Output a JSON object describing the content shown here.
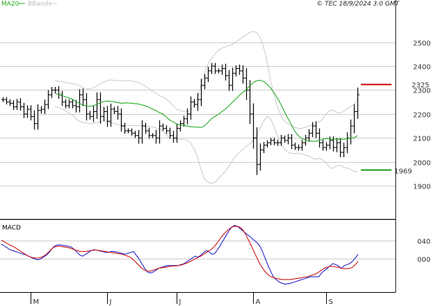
{
  "copyright": "© TEC 18/9/2024 3:0 GMT",
  "colors": {
    "bars": "#000000",
    "ma": "#22aa22",
    "bands": "#c8c8c8",
    "grid": "#cccccc",
    "resistance": "#cc0000",
    "support": "#119911",
    "macd": "#2222cc",
    "signal": "#cc1111",
    "frame": "#000000"
  },
  "chart_data": [
    {
      "type": "ohlc",
      "legend": [
        "MA20",
        "BBands"
      ],
      "y_ticks": [
        "2500",
        "2400",
        "2300",
        "2200",
        "2100",
        "2000",
        "1900"
      ],
      "ylim": [
        1805,
        2612
      ],
      "x_ticks": [
        "M",
        "J",
        "J",
        "A",
        "S"
      ],
      "x_tick_index": [
        8,
        30,
        50,
        72,
        93
      ],
      "levels": [
        {
          "name": "resistance",
          "label": "2325",
          "value": 2325
        },
        {
          "name": "support",
          "label": "1969",
          "value": 1969
        }
      ],
      "close": [
        2260,
        2250,
        2245,
        2230,
        2250,
        2230,
        2200,
        2220,
        2190,
        2160,
        2215,
        2220,
        2240,
        2280,
        2300,
        2300,
        2280,
        2250,
        2235,
        2250,
        2235,
        2230,
        2280,
        2260,
        2200,
        2190,
        2210,
        2260,
        2190,
        2210,
        2170,
        2220,
        2210,
        2200,
        2150,
        2130,
        2130,
        2120,
        2110,
        2100,
        2150,
        2130,
        2110,
        2110,
        2100,
        2150,
        2140,
        2130,
        2110,
        2100,
        2140,
        2160,
        2180,
        2200,
        2250,
        2240,
        2260,
        2320,
        2350,
        2380,
        2400,
        2380,
        2380,
        2390,
        2360,
        2320,
        2370,
        2390,
        2380,
        2350,
        2300,
        2200,
        2100,
        1990,
        2050,
        2070,
        2080,
        2090,
        2080,
        2080,
        2100,
        2090,
        2100,
        2070,
        2060,
        2060,
        2080,
        2100,
        2120,
        2150,
        2120,
        2080,
        2060,
        2070,
        2090,
        2060,
        2080,
        2040,
        2060,
        2100,
        2150,
        2210,
        2280
      ],
      "ma20": [
        2285,
        2282,
        2277,
        2272,
        2267,
        2262,
        2252,
        2245,
        2238,
        2234,
        2232,
        2235,
        2240,
        2247,
        2252,
        2254,
        2253,
        2251,
        2248,
        2245,
        2246,
        2246,
        2245,
        2243,
        2242,
        2238,
        2234,
        2228,
        2221,
        2215,
        2206,
        2200,
        2188,
        2175,
        2167,
        2159,
        2155,
        2152,
        2150,
        2147,
        2146,
        2145,
        2144,
        2150,
        2165,
        2180,
        2190,
        2198,
        2210,
        2220,
        2233,
        2248,
        2262,
        2277,
        2290,
        2302,
        2317,
        2330,
        2339,
        2341,
        2336,
        2325,
        2309,
        2289,
        2266,
        2240,
        2209,
        2182,
        2155,
        2128,
        2109,
        2099,
        2092,
        2088,
        2086,
        2086,
        2090,
        2094,
        2098,
        2096,
        2094,
        2095,
        2095,
        2094,
        2097,
        2100,
        2100,
        2110
      ],
      "bb_upper": [
        2340,
        2337,
        2334,
        2331,
        2329,
        2327,
        2324,
        2319,
        2311,
        2305,
        2305,
        2309,
        2316,
        2326,
        2333,
        2339,
        2342,
        2341,
        2339,
        2339,
        2339,
        2339,
        2338,
        2335,
        2331,
        2325,
        2316,
        2307,
        2296,
        2287,
        2277,
        2271,
        2263,
        2251,
        2234,
        2220,
        2215,
        2211,
        2210,
        2215,
        2235,
        2270,
        2320,
        2370,
        2410,
        2430,
        2450,
        2465,
        2475,
        2480,
        2485,
        2490,
        2500,
        2510,
        2520,
        2530,
        2540,
        2545,
        2540,
        2520,
        2480,
        2420,
        2340,
        2280,
        2230,
        2195,
        2170,
        2160,
        2150,
        2145,
        2140,
        2140,
        2145,
        2150,
        2155,
        2160,
        2165,
        2180,
        2200,
        2215,
        2215,
        2207,
        2203,
        2210,
        2220,
        2230,
        2240,
        2260
      ],
      "bb_lower": [
        2232,
        2227,
        2221,
        2213,
        2205,
        2197,
        2181,
        2170,
        2165,
        2163,
        2160,
        2162,
        2164,
        2167,
        2171,
        2170,
        2165,
        2161,
        2158,
        2151,
        2153,
        2152,
        2152,
        2151,
        2152,
        2151,
        2151,
        2149,
        2146,
        2143,
        2135,
        2128,
        2113,
        2099,
        2099,
        2097,
        2095,
        2093,
        2090,
        2079,
        2056,
        2020,
        1970,
        1930,
        1915,
        1910,
        1915,
        1930,
        1945,
        1960,
        1980,
        2005,
        2025,
        2040,
        2052,
        2065,
        2075,
        2090,
        2110,
        2140,
        2170,
        2190,
        2180,
        2150,
        2110,
        2080,
        2055,
        2040,
        2035,
        2035,
        2035,
        2035,
        2028,
        2026,
        2017,
        2012,
        2015,
        2008,
        1996,
        1977,
        1973,
        1983,
        1987,
        1978,
        1974,
        1970,
        1960,
        1960
      ]
    },
    {
      "type": "line",
      "title": "MACD",
      "y_ticks": [
        "040",
        "000"
      ],
      "ylim": [
        -65,
        75
      ],
      "x_ticks": [
        "M",
        "J",
        "J",
        "A",
        "S"
      ],
      "series": [
        {
          "name": "macd",
          "values": [
            32,
            28,
            24,
            20,
            18,
            16,
            14,
            12,
            10,
            8,
            5,
            2,
            0,
            -2,
            0,
            4,
            8,
            14,
            22,
            28,
            30,
            30,
            29,
            28,
            27,
            25,
            20,
            14,
            8,
            6,
            10,
            14,
            18,
            20,
            19,
            17,
            16,
            14,
            14,
            16,
            16,
            15,
            13,
            12,
            10,
            12,
            14,
            16,
            8,
            0,
            -10,
            -20,
            -28,
            -30,
            -28,
            -24,
            -20,
            -18,
            -16,
            -14,
            -14,
            -14,
            -14,
            -14,
            -12,
            -10,
            -6,
            -2,
            2,
            6,
            4,
            8,
            14,
            18,
            15,
            10,
            12,
            20,
            30,
            40,
            50,
            60,
            68,
            72,
            70,
            65,
            60,
            55,
            50,
            45,
            40,
            35,
            28,
            15,
            0,
            -15,
            -28,
            -40,
            -45,
            -50,
            -52,
            -54,
            -53,
            -52,
            -50,
            -48,
            -46,
            -44,
            -42,
            -40,
            -38,
            -38,
            -38,
            -38,
            -30,
            -25,
            -20,
            -15,
            -10,
            -12,
            -15,
            -20,
            -15,
            -12,
            -10,
            -5,
            2,
            10
          ]
        },
        {
          "name": "signal",
          "values": [
            40,
            37,
            33,
            30,
            27,
            24,
            20,
            16,
            12,
            8,
            5,
            3,
            2,
            2,
            3,
            6,
            10,
            16,
            22,
            26,
            27,
            27,
            26,
            25,
            24,
            22,
            20,
            18,
            16,
            16,
            16,
            17,
            18,
            19,
            19,
            18,
            17,
            16,
            15,
            14,
            13,
            12,
            11,
            10,
            8,
            6,
            3,
            -2,
            -8,
            -14,
            -20,
            -24,
            -26,
            -26,
            -24,
            -22,
            -20,
            -19,
            -18,
            -17,
            -16,
            -15,
            -15,
            -14,
            -13,
            -11,
            -9,
            -6,
            -3,
            0,
            3,
            6,
            10,
            14,
            18,
            22,
            28,
            36,
            44,
            52,
            58,
            64,
            68,
            70,
            70,
            68,
            62,
            52,
            40,
            28,
            15,
            2,
            -10,
            -20,
            -28,
            -34,
            -38,
            -40,
            -42,
            -43,
            -44,
            -44,
            -44,
            -44,
            -43,
            -42,
            -41,
            -40,
            -39,
            -38,
            -36,
            -34,
            -32,
            -28,
            -24,
            -20,
            -18,
            -16,
            -16,
            -17,
            -18,
            -20,
            -21,
            -21,
            -20,
            -18,
            -12,
            -5
          ]
        }
      ]
    }
  ]
}
